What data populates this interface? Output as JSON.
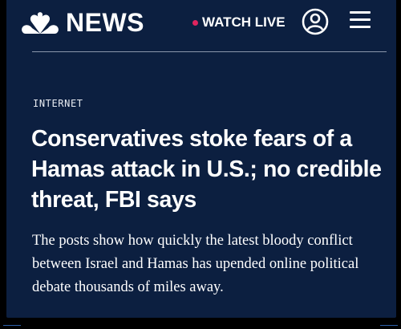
{
  "header": {
    "brand": "NEWS",
    "logo_icon": "nbc-peacock-icon",
    "watch_live_label": "WATCH LIVE",
    "live_dot_color": "#e0245e",
    "account_icon": "account-icon",
    "menu_icon": "hamburger-menu-icon"
  },
  "article": {
    "section": "INTERNET",
    "headline": "Conservatives stoke fears of a Hamas attack in U.S.; no credible threat, FBI says",
    "dek": "The posts show how quickly the latest bloody conflict between Israel and Hamas has upended online political debate thousands of miles away."
  },
  "colors": {
    "background": "#0c1f40",
    "text": "#ffffff",
    "divider": "#8a96ab"
  }
}
